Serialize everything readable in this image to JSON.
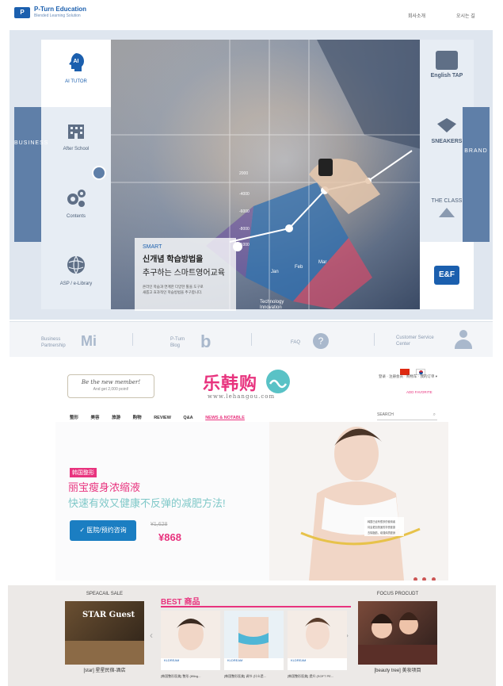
{
  "pturn": {
    "logo_mark": "P",
    "logo_name": "P-Turn Education",
    "logo_sub": "Blended Learning Solution",
    "nav": [
      "회사소개",
      "오시는 길"
    ],
    "left_band": "BUSINESS",
    "right_band": "BRAND",
    "left_items": [
      {
        "label": "AI TUTOR",
        "icon": "ai-head-icon"
      },
      {
        "label": "After School",
        "icon": "building-icon"
      },
      {
        "label": "Contents",
        "icon": "gears-icon"
      },
      {
        "label": "ASP / e-Library",
        "icon": "globe-icon"
      }
    ],
    "right_items": [
      {
        "label": "English TAP",
        "icon": "english-tap-icon"
      },
      {
        "label": "SNEAKERS",
        "icon": "sneakers-icon"
      },
      {
        "label": "THE CLASS",
        "icon": "the-class-icon"
      },
      {
        "label": "E&F",
        "icon": "ef-icon"
      }
    ],
    "hero": {
      "tag": "SMART",
      "line1": "신개념 학습방법을",
      "line2": "추구하는 스마트영어교육",
      "desc1": "온라인 학습과 연계한 다양한 툴을 도구로",
      "desc2": "새롭고 효과적인 학습방법을 추구합니다.",
      "chart_months": [
        "Jan",
        "Feb",
        "Mar"
      ],
      "chart_values": [
        "2000",
        "-4000",
        "-6000",
        "-8000",
        "-1000"
      ],
      "overlay_text": "Technology Innovation"
    },
    "bottom_links": [
      {
        "label": "Business Partnership",
        "icon": "mi-icon"
      },
      {
        "label": "P-Turn Blog",
        "icon": "blog-b-icon"
      },
      {
        "label": "FAQ",
        "icon": "question-bubble-icon"
      },
      {
        "label": "Customer Service Center",
        "icon": "person-icon"
      }
    ]
  },
  "lehan": {
    "member_line1": "Be the new member!",
    "member_line2": "And get 2,000 point!",
    "logo": "乐韩购",
    "logo_url": "www.lehangou.com",
    "top_links": "登录 · 注册会员 · 购物车 · 我的订单 ▾",
    "add_favorite": "ADD FAVORITE",
    "nav": [
      "整形",
      "美容",
      "旅游",
      "购物",
      "REVIEW",
      "Q&A",
      "NEWS & NOTABLE"
    ],
    "search_label": "SEARCH",
    "banner": {
      "tag": "韩国整形",
      "headline1": "丽宝瘦身浓缩液",
      "headline2": "快速有效又健康不反弹的减肥方法!",
      "button": "✓ 医院/预约咨询",
      "old_price": "¥1,628",
      "price": "¥868",
      "notes": [
        "韩国已经有很多的使用者",
        "将会更加快速的享受健康",
        "去除脂肪，增强体质瘦身"
      ]
    },
    "special_title": "SPEACAIL SALE",
    "special_caption": "[star] 星星民宿-酒店",
    "special_img_text": "STAR Guest",
    "best_title": "BEST 商品",
    "best_items": [
      {
        "brand": "KLDREAM",
        "caption": "[韩国整形医美] 整形 (lifting..."
      },
      {
        "brand": "KLDREAM",
        "caption": "[韩国整形医美] 调节 (什么是..."
      },
      {
        "brand": "KLDREAM",
        "caption": "[韩国整形医美] 提升 (SOFT PE..."
      }
    ],
    "focus_title": "FOCUS PROCUDT",
    "focus_caption": "[beauty tree] 美妆项目"
  },
  "colors": {
    "pturn_blue": "#1b5fae",
    "lehan_pink": "#e8337e",
    "lehan_teal": "#7fc8c8"
  }
}
